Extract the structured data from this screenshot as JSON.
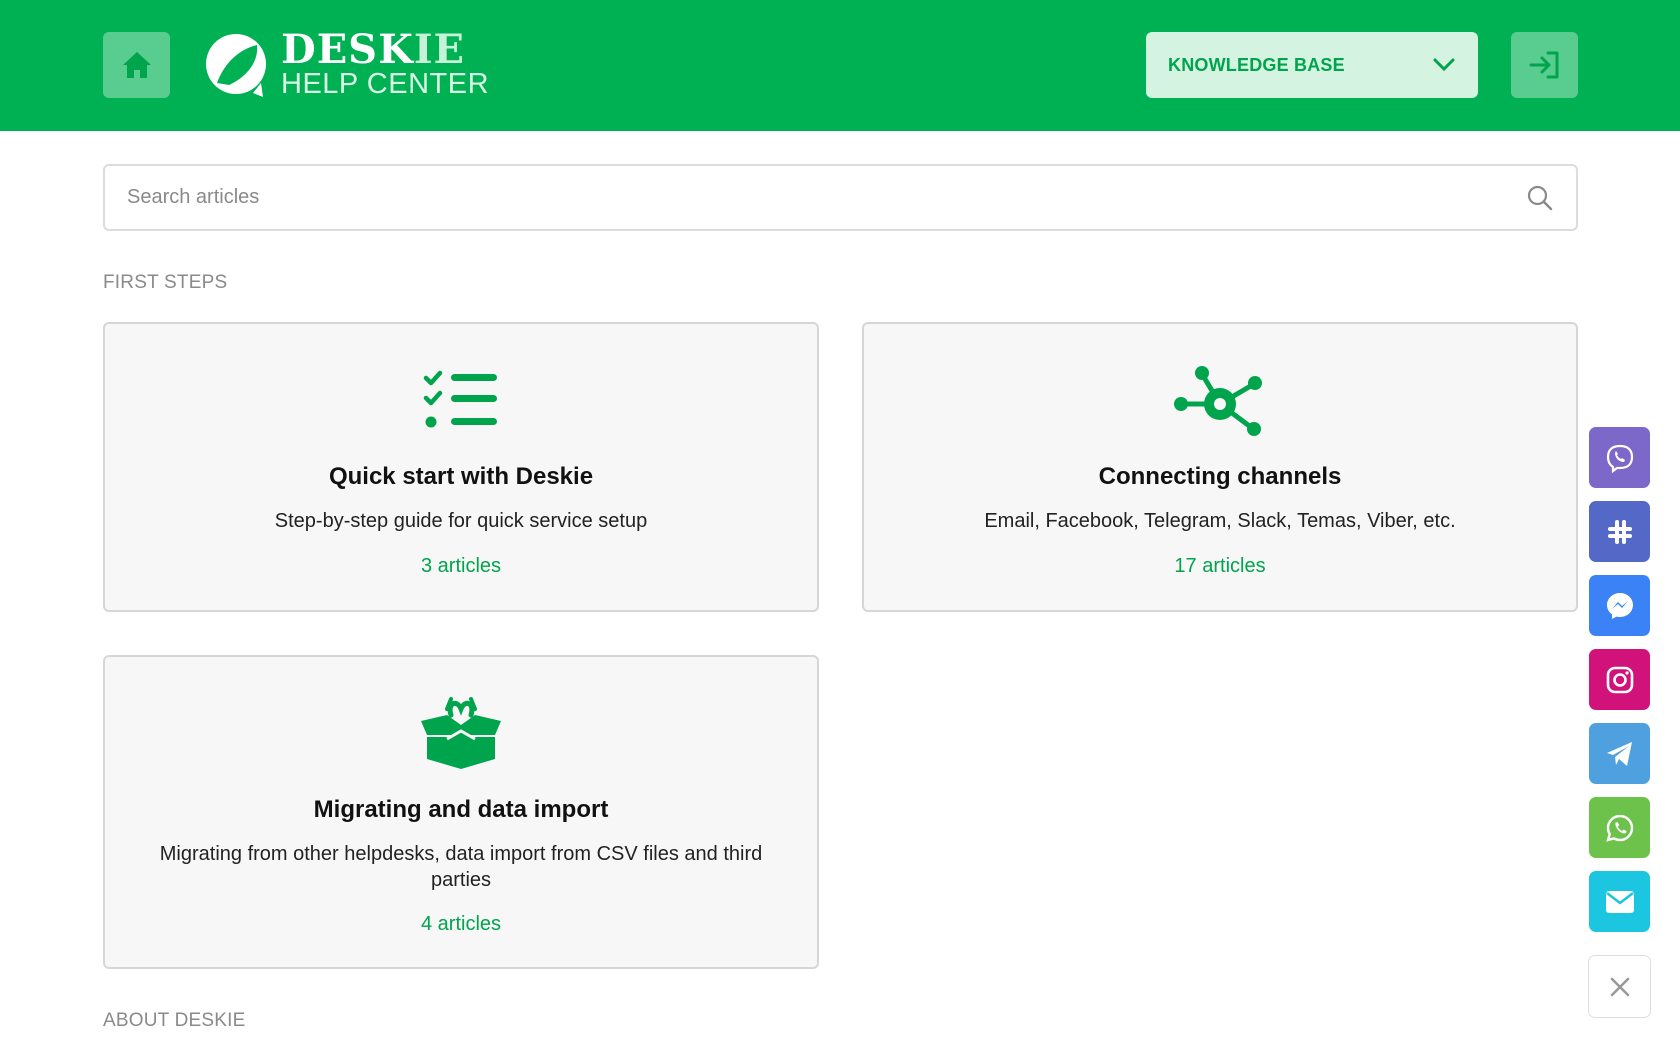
{
  "header": {
    "logo_title_main": "DESK",
    "logo_title_accent": "IE",
    "logo_subtitle": "HELP CENTER",
    "knowledge_select": "KNOWLEDGE BASE",
    "brand_color": "#00b154"
  },
  "search": {
    "placeholder": "Search articles"
  },
  "sections": {
    "first_steps": "FIRST STEPS",
    "about": "ABOUT DESKIE"
  },
  "cards": [
    {
      "icon": "checklist-icon",
      "title": "Quick start with Deskie",
      "description": "Step-by-step guide for quick service setup",
      "count": "3 articles"
    },
    {
      "icon": "network-hub-icon",
      "title": "Connecting channels",
      "description": "Email, Facebook, Telegram, Slack, Temas, Viber, etc.",
      "count": "17 articles"
    },
    {
      "icon": "open-box-icon",
      "title": "Migrating and data import",
      "description": "Migrating from other helpdesks, data import from CSV files and third parties",
      "count": "4 articles"
    }
  ],
  "channels": [
    {
      "name": "viber-icon",
      "color": "#7b68c8"
    },
    {
      "name": "slack-icon",
      "color": "#5468c7"
    },
    {
      "name": "messenger-icon",
      "color": "#3b82f6"
    },
    {
      "name": "instagram-icon",
      "color": "#d1127a"
    },
    {
      "name": "telegram-icon",
      "color": "#4fa0de"
    },
    {
      "name": "whatsapp-icon",
      "color": "#6cc24a"
    },
    {
      "name": "email-icon",
      "color": "#1cc6e0"
    }
  ]
}
